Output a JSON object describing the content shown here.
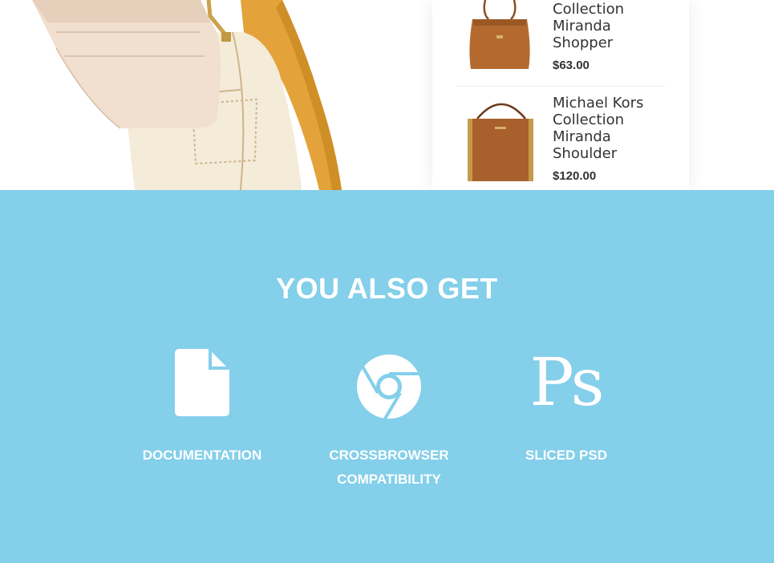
{
  "products": [
    {
      "name": "Collection Miranda Shopper",
      "price": "$63.00"
    },
    {
      "name": "Michael Kors Collection Miranda Shoulder",
      "price": "$120.00"
    }
  ],
  "features_section": {
    "title": "YOU ALSO GET",
    "background": "#84cfea",
    "items": [
      {
        "icon": "document-icon",
        "label": "DOCUMENTATION"
      },
      {
        "icon": "chrome-icon",
        "label": "CROSSBROWSER COMPATIBILITY"
      },
      {
        "icon": "photoshop-icon",
        "icon_text": "Ps",
        "label": "SLICED PSD"
      }
    ]
  }
}
